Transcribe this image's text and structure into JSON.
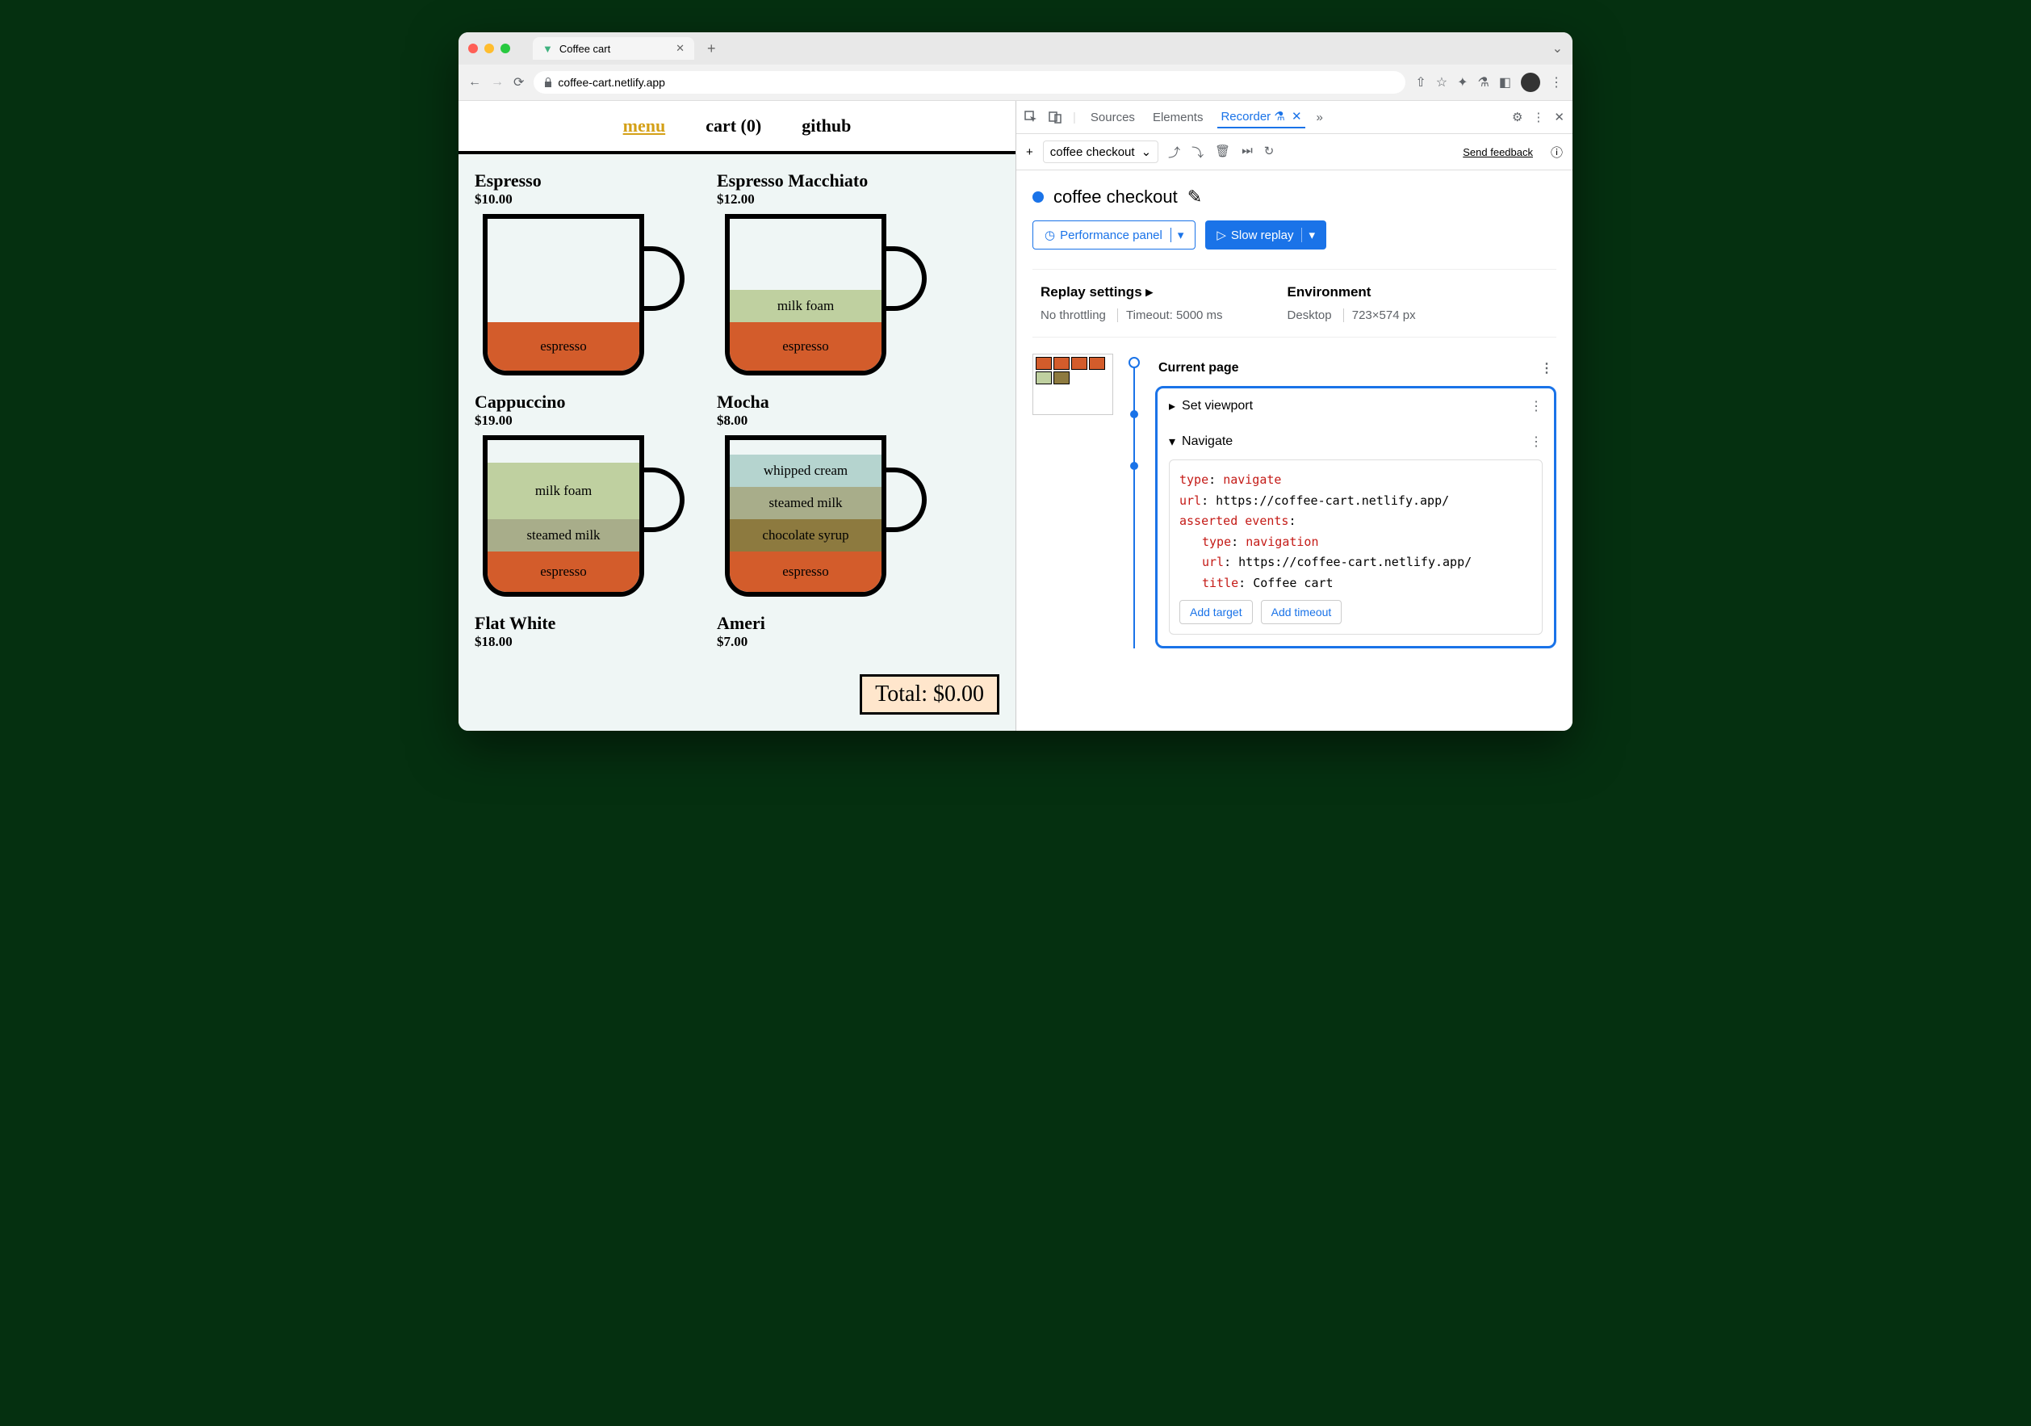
{
  "browser": {
    "tab_title": "Coffee cart",
    "url": "coffee-cart.netlify.app"
  },
  "page": {
    "nav": {
      "menu": "menu",
      "cart": "cart (0)",
      "github": "github"
    },
    "products": [
      {
        "name": "Espresso",
        "price": "$10.00"
      },
      {
        "name": "Espresso Macchiato",
        "price": "$12.00"
      },
      {
        "name": "Cappuccino",
        "price": "$19.00"
      },
      {
        "name": "Mocha",
        "price": "$8.00"
      },
      {
        "name": "Flat White",
        "price": "$18.00"
      },
      {
        "name": "Ameri",
        "price": "$7.00"
      }
    ],
    "layers": {
      "espresso": "espresso",
      "milkfoam": "milk foam",
      "steamed": "steamed milk",
      "choco": "chocolate syrup",
      "whipped": "whipped cream"
    },
    "total": "Total: $0.00"
  },
  "devtools": {
    "tabs": {
      "sources": "Sources",
      "elements": "Elements",
      "recorder": "Recorder"
    },
    "toolbar": {
      "recording_name": "coffee checkout",
      "feedback": "Send feedback"
    },
    "title": "coffee checkout",
    "buttons": {
      "perf": "Performance panel",
      "replay": "Slow replay"
    },
    "settings": {
      "replay_heading": "Replay settings",
      "throttle": "No throttling",
      "timeout": "Timeout: 5000 ms",
      "env_heading": "Environment",
      "env_type": "Desktop",
      "env_size": "723×574 px"
    },
    "steps": {
      "current": "Current page",
      "viewport": "Set viewport",
      "navigate": "Navigate",
      "details": {
        "type_k": "type",
        "type_v": "navigate",
        "url_k": "url",
        "url_v": "https://coffee-cart.netlify.app/",
        "ae_k": "asserted events",
        "nav_v": "navigation",
        "title_k": "title",
        "title_v": "Coffee cart"
      },
      "add_target": "Add target",
      "add_timeout": "Add timeout"
    }
  }
}
